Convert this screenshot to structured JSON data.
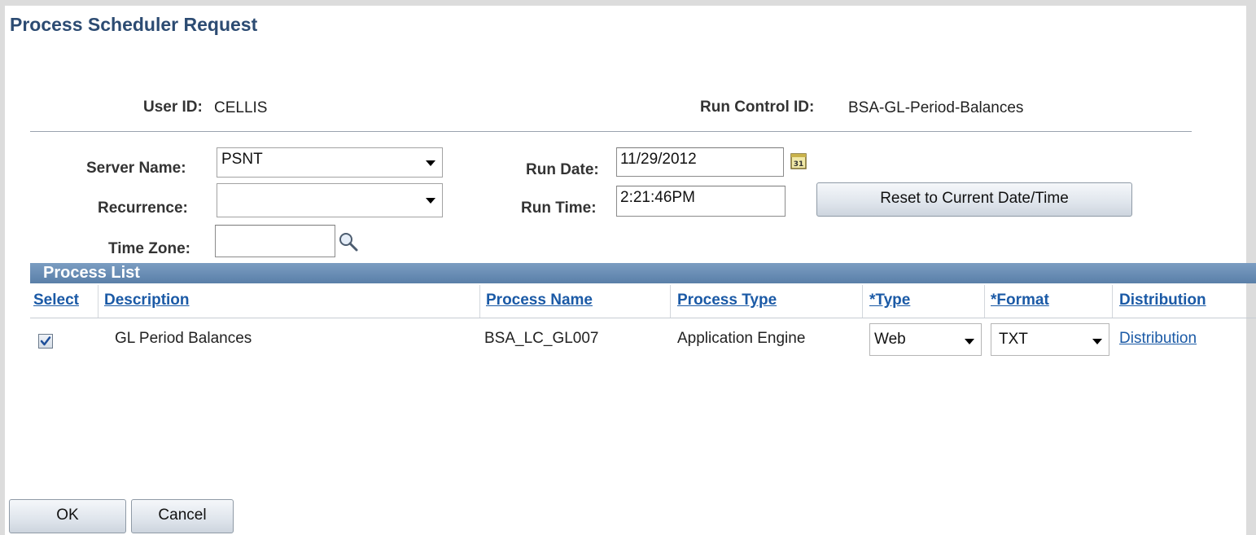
{
  "page": {
    "title": "Process Scheduler Request"
  },
  "header_info": {
    "user_id_label": "User ID:",
    "user_id_value": "CELLIS",
    "run_control_label": "Run Control ID:",
    "run_control_value": "BSA-GL-Period-Balances"
  },
  "form": {
    "server_name_label": "Server Name:",
    "server_name_value": "PSNT",
    "recurrence_label": "Recurrence:",
    "recurrence_value": "",
    "time_zone_label": "Time Zone:",
    "time_zone_value": "",
    "run_date_label": "Run Date:",
    "run_date_value": "11/29/2012",
    "run_time_label": "Run Time:",
    "run_time_value": "2:21:46PM",
    "reset_button_label": "Reset to Current Date/Time",
    "calendar_icon": "calendar-icon",
    "lookup_icon": "magnifier-lookup-icon"
  },
  "process_list": {
    "title": "Process List",
    "columns": [
      "Select",
      "Description",
      "Process Name",
      "Process Type",
      "*Type",
      "*Format",
      "Distribution"
    ],
    "rows": [
      {
        "selected": true,
        "description": "GL Period Balances",
        "process_name": "BSA_LC_GL007",
        "process_type": "Application Engine",
        "type": "Web",
        "format": "TXT",
        "distribution": "Distribution"
      }
    ]
  },
  "footer": {
    "ok_label": "OK",
    "cancel_label": "Cancel"
  },
  "colors": {
    "title": "#2c4b72",
    "grid_header": "#5a7fa8",
    "link": "#1b5aa6"
  }
}
